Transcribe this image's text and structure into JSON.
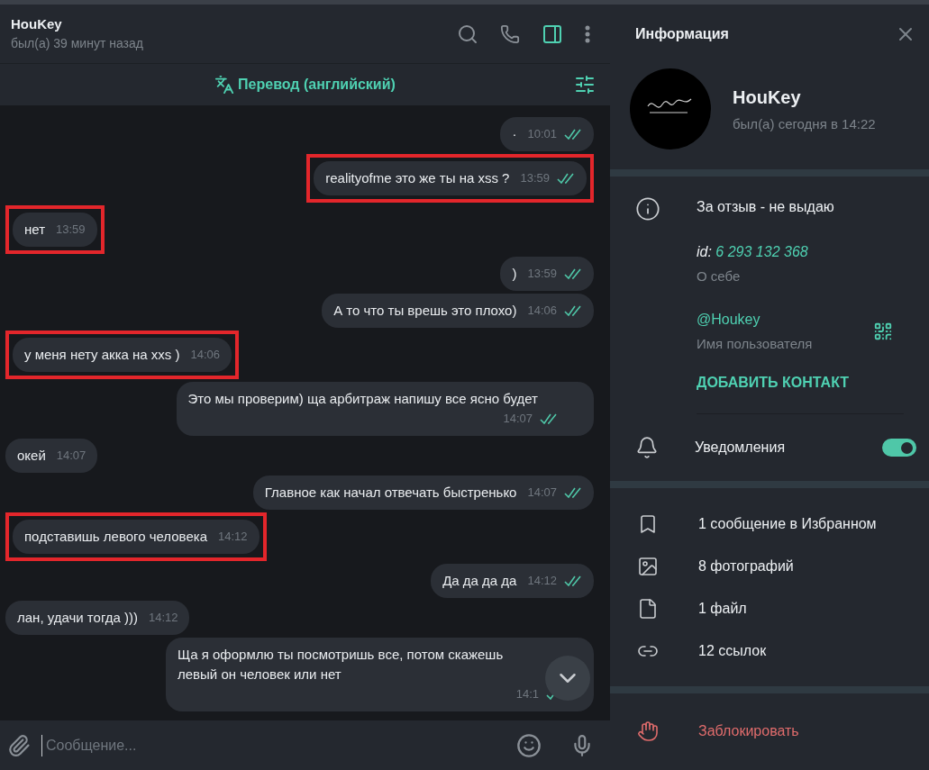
{
  "chat": {
    "title": "HouKey",
    "status": "был(а) 39 минут назад"
  },
  "translate_bar": {
    "label": "Перевод (английский)"
  },
  "messages": [
    {
      "kind": "outgoing",
      "text": "·",
      "time": "10:01",
      "read": true,
      "highlighted": false
    },
    {
      "kind": "outgoing",
      "text": "realityofme это же ты на xss ?",
      "time": "13:59",
      "read": true,
      "highlighted": true
    },
    {
      "kind": "incoming",
      "text": "нет",
      "time": "13:59",
      "highlighted": true
    },
    {
      "kind": "outgoing",
      "text": ")",
      "time": "13:59",
      "read": true,
      "highlighted": false
    },
    {
      "kind": "outgoing",
      "text": "А то что ты врешь это плохо)",
      "time": "14:06",
      "read": true,
      "highlighted": false
    },
    {
      "kind": "incoming",
      "text": "у меня нету акка на xxs )",
      "time": "14:06",
      "highlighted": true
    },
    {
      "kind": "outgoing",
      "text": "Это мы проверим) ща арбитраж напишу все ясно будет",
      "time": "14:07",
      "read": true,
      "highlighted": false
    },
    {
      "kind": "incoming",
      "text": "окей",
      "time": "14:07",
      "highlighted": false
    },
    {
      "kind": "outgoing",
      "text": "Главное как начал отвечать быстренько",
      "time": "14:07",
      "read": true,
      "highlighted": false
    },
    {
      "kind": "incoming",
      "text": "подставишь левого человека",
      "time": "14:12",
      "highlighted": true
    },
    {
      "kind": "outgoing",
      "text": "Да да да да",
      "time": "14:12",
      "read": true,
      "highlighted": false
    },
    {
      "kind": "incoming",
      "text": "лан, удачи тогда )))",
      "time": "14:12",
      "highlighted": false
    },
    {
      "kind": "outgoing",
      "text": "Ща я оформлю ты посмотришь все, потом скажешь левый он человек или нет",
      "time": "14:1",
      "read": false,
      "highlighted": false
    }
  ],
  "composer": {
    "placeholder": "Сообщение..."
  },
  "info_panel": {
    "title": "Информация",
    "name": "HouKey",
    "last_seen": "был(а) сегодня в 14:22",
    "bio": "За отзыв - не выдаю",
    "id_label": "id:",
    "id_value": "6 293 132 368",
    "bio_caption": "О себе",
    "username": "@Houkey",
    "username_caption": "Имя пользователя",
    "add_contact": "ДОБАВИТЬ КОНТАКТ",
    "notifications": {
      "label": "Уведомления",
      "on": true
    },
    "media": [
      {
        "kind": "saved",
        "label": "1 сообщение в Избранном"
      },
      {
        "kind": "photos",
        "label": "8 фотографий"
      },
      {
        "kind": "files",
        "label": "1 файл"
      },
      {
        "kind": "links",
        "label": "12 ссылок"
      }
    ],
    "block": "Заблокировать"
  }
}
